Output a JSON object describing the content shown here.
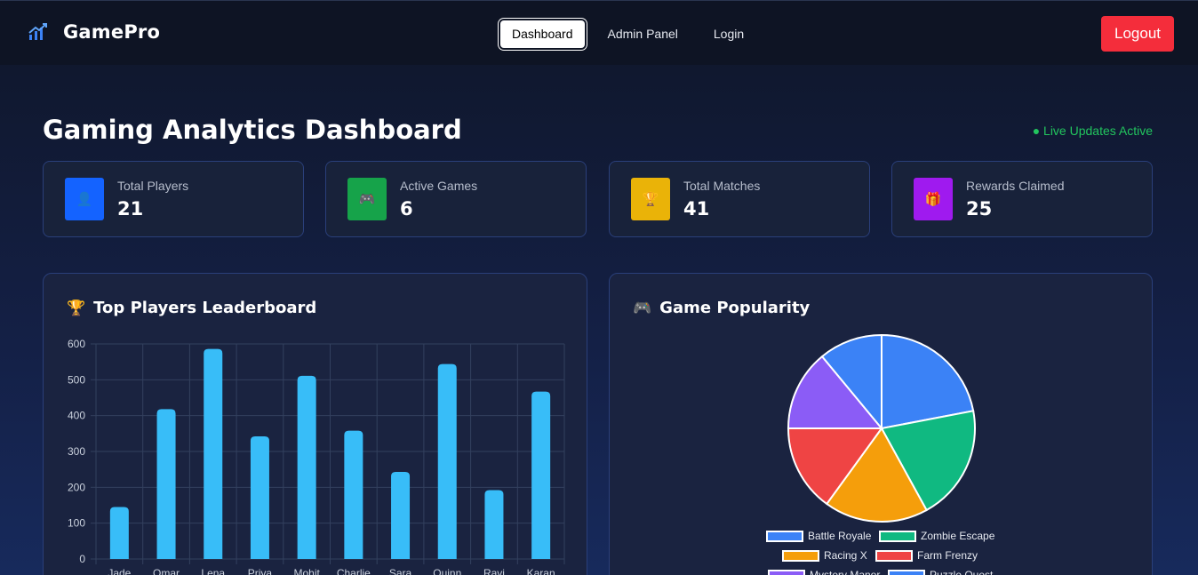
{
  "nav": {
    "brand": "GamePro",
    "brand_icon": "chart-growth-icon",
    "links": [
      "Dashboard",
      "Admin Panel",
      "Login"
    ],
    "active": "Dashboard",
    "logout_label": "Logout"
  },
  "header": {
    "title": "Gaming Analytics Dashboard",
    "status": "● Live Updates Active"
  },
  "stats": [
    {
      "label": "Total Players",
      "value": "21",
      "icon": "player-icon",
      "glyph": "👤",
      "color": "#1463ff"
    },
    {
      "label": "Active Games",
      "value": "6",
      "icon": "gamepad-icon",
      "glyph": "🎮",
      "color": "#16a34a"
    },
    {
      "label": "Total Matches",
      "value": "41",
      "icon": "trophy-icon",
      "glyph": "🏆",
      "color": "#eab308"
    },
    {
      "label": "Rewards Claimed",
      "value": "25",
      "icon": "gift-icon",
      "glyph": "🎁",
      "color": "#9f1aef"
    }
  ],
  "leaderboard": {
    "title": "Top Players Leaderboard",
    "emoji": "🏆"
  },
  "popularity": {
    "title": "Game Popularity",
    "emoji": "🎮"
  },
  "chart_data": [
    {
      "type": "bar",
      "title": "Top Players Leaderboard",
      "categories": [
        "Jade",
        "Omar",
        "Lena",
        "Priya",
        "Mohit",
        "Charlie",
        "Sara",
        "Quinn",
        "Ravi",
        "Karan"
      ],
      "values": [
        145,
        418,
        586,
        342,
        511,
        358,
        243,
        544,
        192,
        467
      ],
      "ylim": [
        0,
        600
      ],
      "yticks": [
        0,
        100,
        200,
        300,
        400,
        500,
        600
      ],
      "grid": true,
      "bar_color": "#38bdf8"
    },
    {
      "type": "pie",
      "title": "Game Popularity",
      "categories": [
        "Battle Royale",
        "Zombie Escape",
        "Racing X",
        "Farm Frenzy",
        "Mystery Manor",
        "Puzzle Quest"
      ],
      "values": [
        22,
        20,
        18,
        15,
        14,
        11
      ],
      "colors": [
        "#3b82f6",
        "#10b981",
        "#f59e0b",
        "#ef4444",
        "#8b5cf6",
        "#3b82f6"
      ],
      "legend": "bottom"
    }
  ]
}
